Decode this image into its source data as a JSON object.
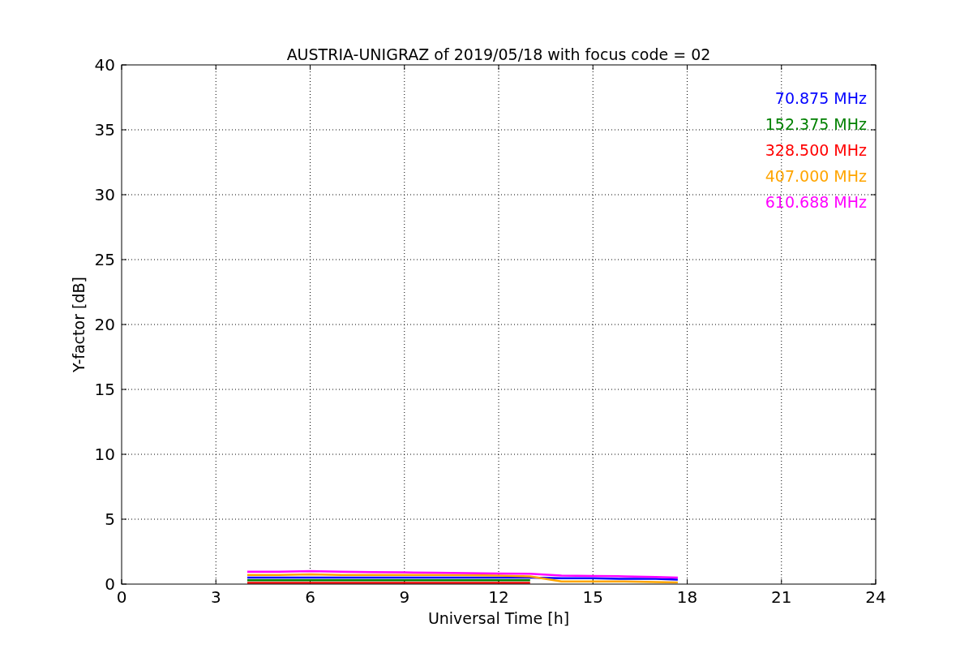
{
  "chart_data": {
    "type": "line",
    "title": "AUSTRIA-UNIGRAZ of 2019/05/18 with focus code = 02",
    "xlabel": "Universal Time [h]",
    "ylabel": "Y-factor [dB]",
    "x": [
      4,
      5,
      6,
      7,
      8,
      9,
      10,
      11,
      12,
      13,
      14,
      15,
      16,
      17,
      17.7
    ],
    "series": [
      {
        "name": "70.875 MHz",
        "color": "#0000ff",
        "values": [
          0.5,
          0.5,
          0.5,
          0.5,
          0.5,
          0.5,
          0.5,
          0.5,
          0.5,
          0.5,
          0.45,
          0.45,
          0.4,
          0.4,
          0.35
        ]
      },
      {
        "name": "152.375 MHz",
        "color": "#008000",
        "values": [
          0.3,
          0.3,
          0.3,
          0.3,
          0.3,
          0.3,
          0.3,
          0.3,
          0.3,
          0.3,
          null,
          null,
          null,
          null,
          null
        ]
      },
      {
        "name": "328.500 MHz",
        "color": "#ff0000",
        "values": [
          0.1,
          0.1,
          0.1,
          0.1,
          0.1,
          0.1,
          0.1,
          0.1,
          0.1,
          0.1,
          null,
          null,
          null,
          null,
          null
        ]
      },
      {
        "name": "407.000 MHz",
        "color": "#ffa500",
        "values": [
          0.7,
          0.7,
          0.75,
          0.7,
          0.7,
          0.7,
          0.7,
          0.68,
          0.65,
          0.6,
          0.2,
          0.2,
          0.2,
          0.15,
          0.12
        ]
      },
      {
        "name": "610.688 MHz",
        "color": "#ff00ff",
        "values": [
          0.95,
          0.95,
          1.0,
          0.95,
          0.92,
          0.9,
          0.88,
          0.85,
          0.82,
          0.8,
          0.65,
          0.62,
          0.6,
          0.55,
          0.5
        ]
      }
    ],
    "xlim": [
      0,
      24
    ],
    "ylim": [
      0,
      40
    ],
    "xticks": [
      0,
      3,
      6,
      9,
      12,
      15,
      18,
      21,
      24
    ],
    "yticks": [
      0,
      5,
      10,
      15,
      20,
      25,
      30,
      35,
      40
    ],
    "grid": true
  }
}
